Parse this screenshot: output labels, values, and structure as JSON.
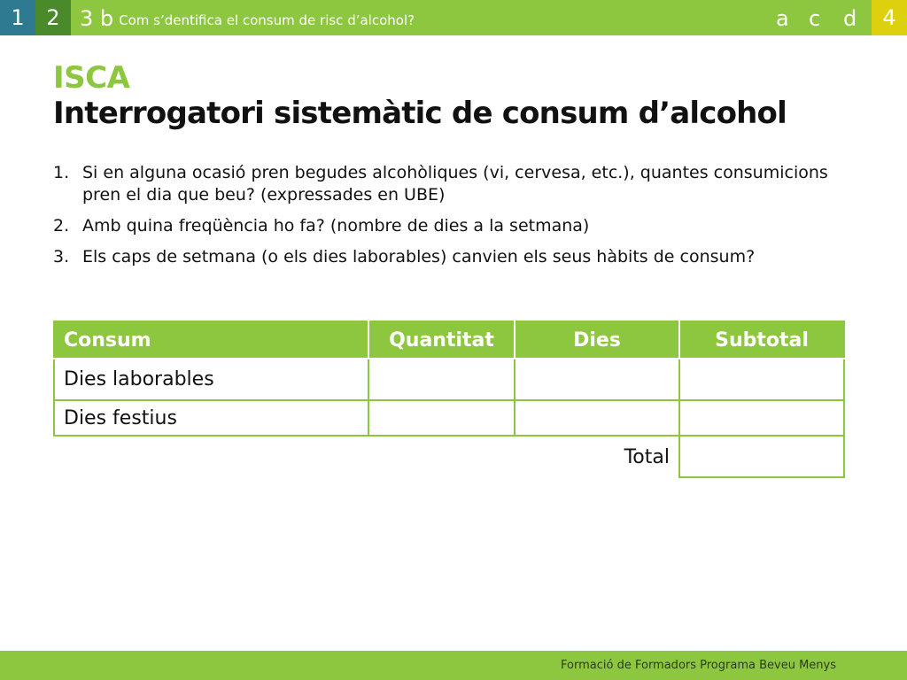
{
  "nav": {
    "tab1": "1",
    "tab2": "2",
    "tab3b": "3 b",
    "section_title": "Com s’dentifica el consum de risc d’alcohol?",
    "link_a": "a",
    "link_c": "c",
    "link_d": "d",
    "tab4": "4"
  },
  "colors": {
    "accent_green": "#8dc63f",
    "tab1_blue": "#2e7a90",
    "tab2_green": "#4a8a2a",
    "tab4_yellow": "#ddd10f"
  },
  "title": {
    "acronym": "ISCA",
    "heading": "Interrogatori sistemàtic de consum d’alcohol"
  },
  "questions": [
    {
      "num": "1.",
      "text": "Si en alguna ocasió pren begudes alcohòliques (vi, cervesa, etc.), quantes consumicions pren el dia que beu? (expressades en UBE)"
    },
    {
      "num": "2.",
      "text": "Amb quina freqüència ho fa? (nombre de dies a la setmana)"
    },
    {
      "num": "3.",
      "text": "Els caps de setmana (o els dies laborables) canvien els seus hàbits de consum?"
    }
  ],
  "table": {
    "headers": [
      "Consum",
      "Quantitat",
      "Dies",
      "Subtotal"
    ],
    "rows": [
      {
        "label": "Dies laborables",
        "quantitat": "",
        "dies": "",
        "subtotal": ""
      },
      {
        "label": "Dies festius",
        "quantitat": "",
        "dies": "",
        "subtotal": ""
      }
    ],
    "total_label": "Total",
    "total_value": ""
  },
  "footer": {
    "text": "Formació de Formadors Programa Beveu Menys"
  }
}
